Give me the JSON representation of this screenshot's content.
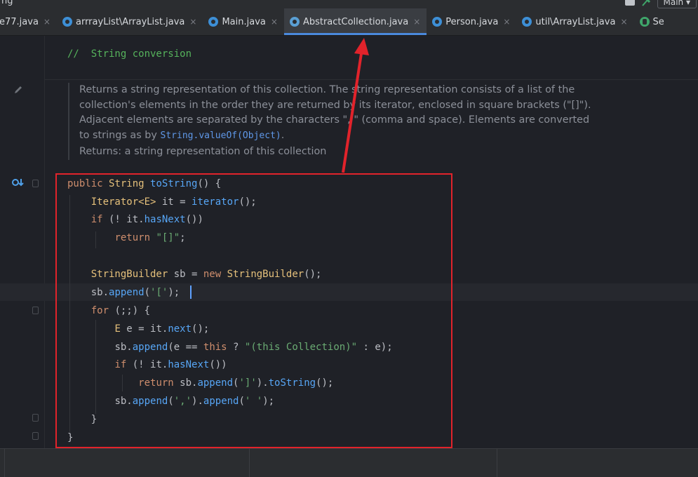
{
  "window": {
    "title": "ng",
    "run_config": "Main"
  },
  "tabs": [
    {
      "label": "e77.java",
      "icon": "none",
      "active": false
    },
    {
      "label": "arrrayList\\ArrayList.java",
      "icon": "class-icon",
      "active": false
    },
    {
      "label": "Main.java",
      "icon": "main-class-icon",
      "active": false
    },
    {
      "label": "AbstractCollection.java",
      "icon": "abstract-class-icon",
      "active": true
    },
    {
      "label": "Person.java",
      "icon": "class-icon",
      "active": false
    },
    {
      "label": "util\\ArrayList.java",
      "icon": "class-icon",
      "active": false
    },
    {
      "label": "Se",
      "icon": "interface-icon",
      "active": false
    }
  ],
  "tab_close_glyph": "×",
  "editor": {
    "section_comment": "//  String conversion",
    "doc": {
      "line1": "Returns a string representation of this collection. The string representation consists of a list of the",
      "line2": "collection's elements in the order they are returned by its iterator, enclosed in square brackets (\"[]\").",
      "line3": "Adjacent elements are separated by the characters \", \" (comma and space). Elements are converted",
      "line4_prefix": "to strings as by ",
      "line4_link": "String.valueOf(Object)",
      "line4_suffix": ".",
      "returns": "Returns: a string representation of this collection"
    },
    "code": {
      "l1_kw": "public",
      "l1_type": "String",
      "l1_fn": "toString",
      "l1_rest": "() {",
      "l2_type": "Iterator<E>",
      "l2_mid": " it = ",
      "l2_fn": "iterator",
      "l2_rest": "();",
      "l3_kw": "if",
      "l3_mid": " (! it.",
      "l3_fn": "hasNext",
      "l3_rest": "())",
      "l4_kw": "return",
      "l4_str": "\"[]\"",
      "l4_rest": ";",
      "l6_type": "StringBuilder",
      "l6_mid": " sb = ",
      "l6_kw": "new",
      "l6_type2": "StringBuilder",
      "l6_rest": "();",
      "l7_pre": "sb.",
      "l7_fn": "append",
      "l7_open": "(",
      "l7_str": "'['",
      "l7_rest": ");",
      "l8_kw": "for",
      "l8_rest": " (;;) {",
      "l9_type": "E",
      "l9_mid": " e = it.",
      "l9_fn": "next",
      "l9_rest": "();",
      "l10_pre": "sb.",
      "l10_fn": "append",
      "l10_mid": "(e == ",
      "l10_kw": "this",
      "l10_mid2": " ? ",
      "l10_str": "\"(this Collection)\"",
      "l10_rest": " : e);",
      "l11_kw": "if",
      "l11_mid": " (! it.",
      "l11_fn": "hasNext",
      "l11_rest": "())",
      "l12_kw": "return",
      "l12_mid": " sb.",
      "l12_fn": "append",
      "l12_open": "(",
      "l12_str": "']'",
      "l12_mid2": ").",
      "l12_fn2": "toString",
      "l12_rest": "();",
      "l13_pre": "sb.",
      "l13_fn": "append",
      "l13_open": "(",
      "l13_str": "','",
      "l13_mid": ").",
      "l13_fn2": "append",
      "l13_open2": "(",
      "l13_str2": "' '",
      "l13_rest": ");",
      "l14": "}",
      "l15": "}"
    }
  },
  "colors": {
    "keyword": "#cf8e6d",
    "type": "#e5c07b",
    "function": "#57a6f6",
    "string": "#6aab73",
    "annotation_box": "#e1232b",
    "active_tab_underline": "#4a89dc"
  }
}
